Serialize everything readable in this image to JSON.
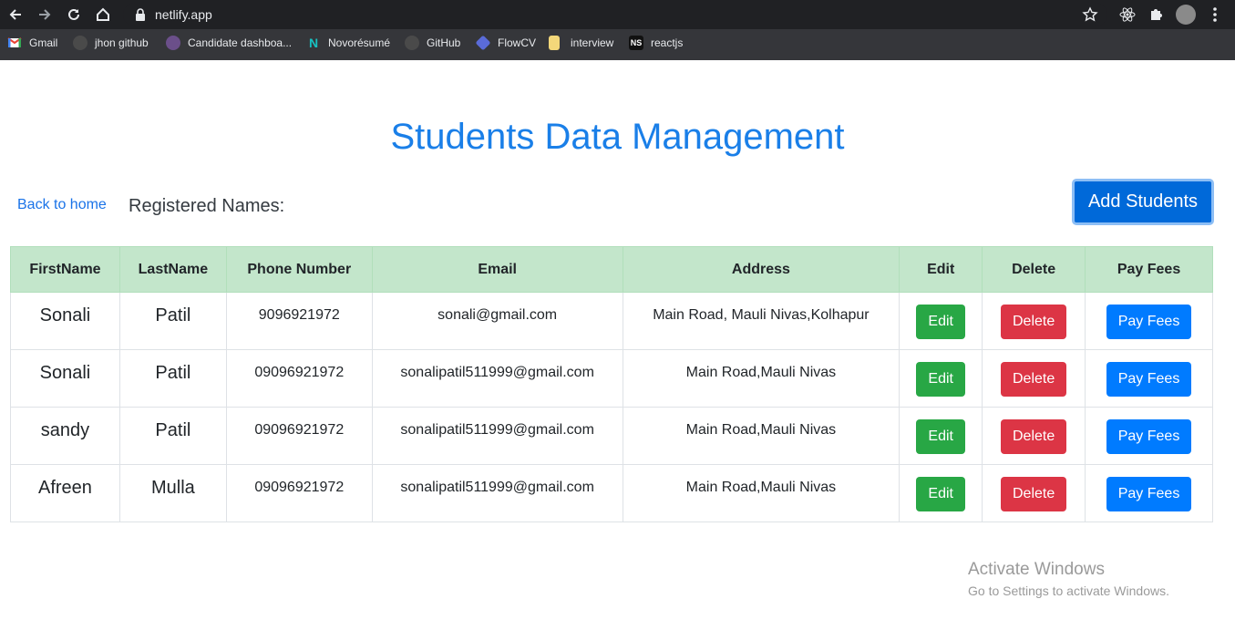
{
  "browser": {
    "url": "netlify.app",
    "bookmarks": [
      {
        "label": "Gmail",
        "icon": "gmail-icon"
      },
      {
        "label": "jhon github",
        "icon": "github-icon"
      },
      {
        "label": "Candidate dashboa...",
        "icon": "candidate-icon"
      },
      {
        "label": "Novorésumé",
        "icon": "novoresume-icon"
      },
      {
        "label": "GitHub",
        "icon": "github-icon"
      },
      {
        "label": "FlowCV",
        "icon": "flowcv-icon"
      },
      {
        "label": "interview",
        "icon": "folder-icon"
      },
      {
        "label": "reactjs",
        "icon": "ns-icon",
        "badge": "NS"
      }
    ]
  },
  "page": {
    "title": "Students Data Management",
    "back_link": "Back to home",
    "registered_label": "Registered Names:",
    "add_button": "Add Students"
  },
  "table": {
    "headers": [
      "FirstName",
      "LastName",
      "Phone Number",
      "Email",
      "Address",
      "Edit",
      "Delete",
      "Pay Fees"
    ],
    "rows": [
      {
        "first": "Sonali",
        "last": "Patil",
        "phone": "9096921972",
        "email": "sonali@gmail.com",
        "address": "Main Road, Mauli Nivas,Kolhapur",
        "edit": "Edit",
        "delete": "Delete",
        "pay": "Pay Fees"
      },
      {
        "first": "Sonali",
        "last": "Patil",
        "phone": "09096921972",
        "email": "sonalipatil511999@gmail.com",
        "address": "Main Road,Mauli Nivas",
        "edit": "Edit",
        "delete": "Delete",
        "pay": "Pay Fees"
      },
      {
        "first": "sandy",
        "last": "Patil",
        "phone": "09096921972",
        "email": "sonalipatil511999@gmail.com",
        "address": "Main Road,Mauli Nivas",
        "edit": "Edit",
        "delete": "Delete",
        "pay": "Pay Fees"
      },
      {
        "first": "Afreen",
        "last": "Mulla",
        "phone": "09096921972",
        "email": "sonalipatil511999@gmail.com",
        "address": "Main Road,Mauli Nivas",
        "edit": "Edit",
        "delete": "Delete",
        "pay": "Pay Fees"
      }
    ]
  },
  "watermark": {
    "line1": "Activate Windows",
    "line2": "Go to Settings to activate Windows."
  },
  "colors": {
    "title": "#1a7fe8",
    "header_bg": "#c3e6cb",
    "edit": "#28a745",
    "delete": "#dc3545",
    "pay": "#007bff",
    "add": "#0069d9"
  }
}
